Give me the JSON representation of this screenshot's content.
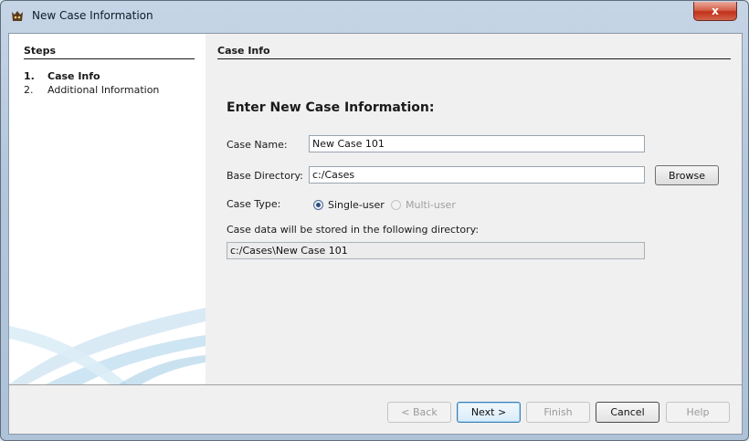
{
  "window": {
    "title": "New Case Information",
    "close_label": "x"
  },
  "steps": {
    "header": "Steps",
    "items": [
      {
        "num": "1.",
        "label": "Case Info"
      },
      {
        "num": "2.",
        "label": "Additional Information"
      }
    ]
  },
  "content": {
    "header": "Case Info",
    "heading": "Enter New Case Information:",
    "case_name_label": "Case Name:",
    "case_name_value": "New Case 101",
    "base_dir_label": "Base Directory:",
    "base_dir_value": "c:/Cases",
    "browse_label": "Browse",
    "case_type_label": "Case Type:",
    "case_type_options": [
      {
        "label": "Single-user",
        "selected": true,
        "enabled": true
      },
      {
        "label": "Multi-user",
        "selected": false,
        "enabled": false
      }
    ],
    "stored_label": "Case data will be stored in the following directory:",
    "stored_path": "c:/Cases\\New Case 101"
  },
  "buttons": {
    "back": "< Back",
    "next": "Next >",
    "finish": "Finish",
    "cancel": "Cancel",
    "help": "Help"
  },
  "colors": {
    "accent": "#3c7fb1",
    "close": "#c1311a"
  }
}
